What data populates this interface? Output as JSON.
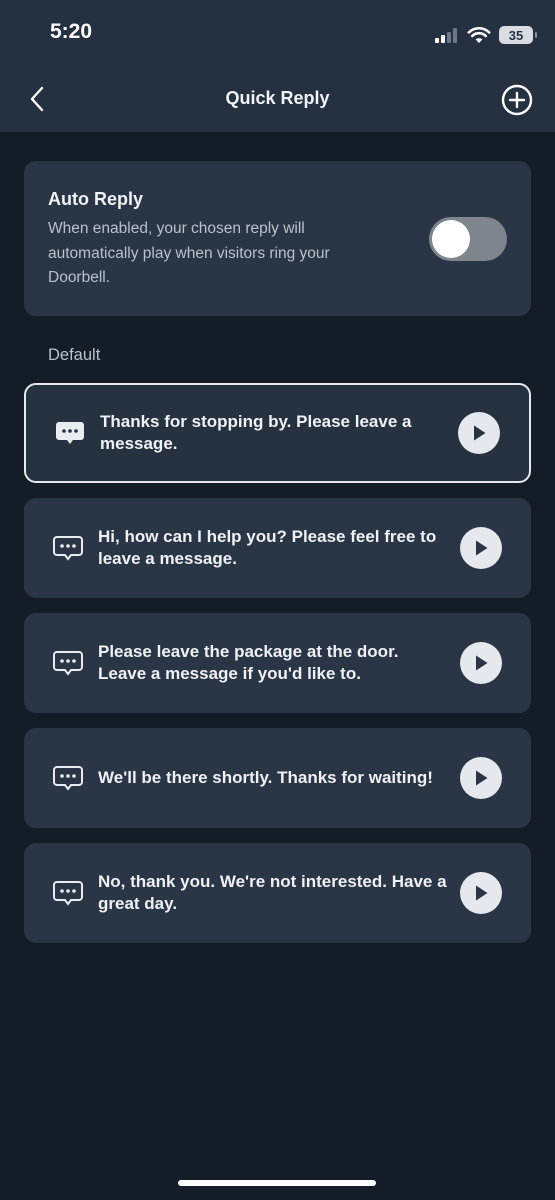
{
  "status": {
    "time": "5:20",
    "battery": "35"
  },
  "nav": {
    "title": "Quick Reply",
    "back_icon": "chevron-left-icon",
    "add_icon": "plus-circle-icon"
  },
  "auto_reply": {
    "title": "Auto Reply",
    "description": "When enabled, your chosen reply will automatically play when visitors ring your Doorbell.",
    "enabled": false
  },
  "section_label": "Default",
  "replies": [
    {
      "text": "Thanks for stopping by. Please leave a message.",
      "selected": true
    },
    {
      "text": "Hi, how can I help you? Please feel free to leave a message.",
      "selected": false
    },
    {
      "text": "Please leave the package at the door. Leave a message if you'd like to.",
      "selected": false
    },
    {
      "text": "We'll be there shortly. Thanks for waiting!",
      "selected": false
    },
    {
      "text": "No, thank you. We're not interested. Have a great day.",
      "selected": false
    }
  ]
}
